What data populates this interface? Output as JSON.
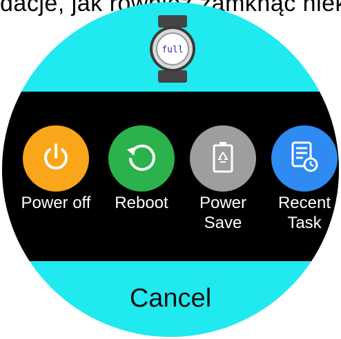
{
  "top_text": "dacje, jak również zamknąć niektó",
  "watch_icon": {
    "name": "watch-icon",
    "label": "full"
  },
  "actions": [
    {
      "label": "Power off",
      "icon": "power-icon",
      "color": "#f9a61a"
    },
    {
      "label": "Reboot",
      "icon": "reboot-icon",
      "color": "#2bb24c"
    },
    {
      "label": "Power\nSave",
      "icon": "battery-saver-icon",
      "color": "#9e9e9e"
    },
    {
      "label": "Recent\nTask",
      "icon": "recent-task-icon",
      "color": "#2f8af2"
    }
  ],
  "cancel_label": "Cancel",
  "colors": {
    "face": "#21e9f0",
    "band": "#000000"
  }
}
